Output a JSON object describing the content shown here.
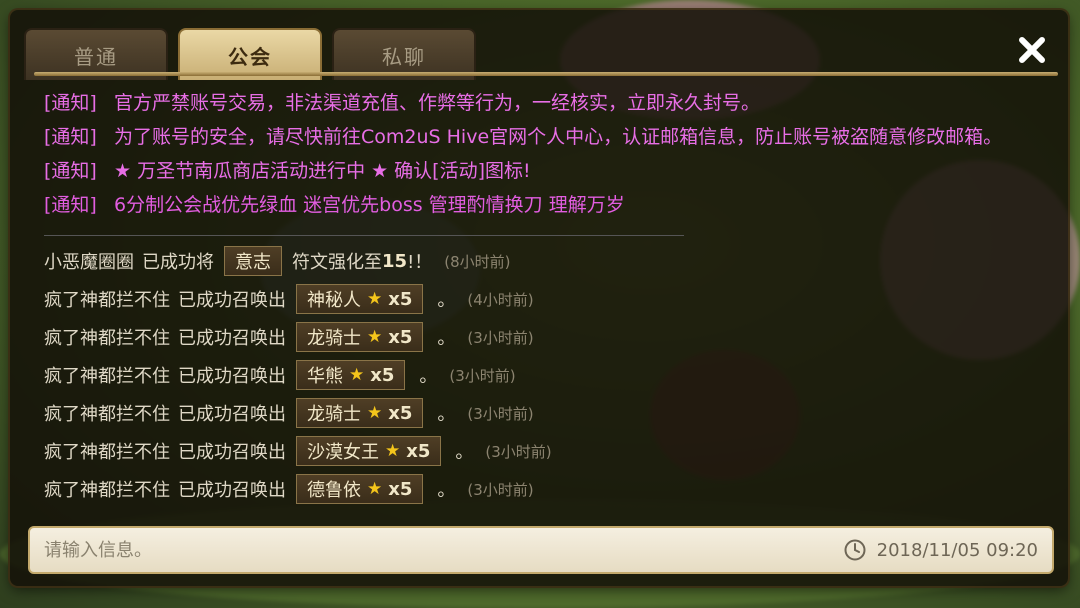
{
  "tabs": [
    {
      "label": "普通",
      "active": false
    },
    {
      "label": "公会",
      "active": true
    },
    {
      "label": "私聊",
      "active": false
    }
  ],
  "close_icon": "close-icon",
  "notices": [
    {
      "tag": "[通知]",
      "text": "官方严禁账号交易，非法渠道充值、作弊等行为，一经核实，立即永久封号。"
    },
    {
      "tag": "[通知]",
      "text": "为了账号的安全，请尽快前往Com2uS Hive官网个人中心，认证邮箱信息，防止账号被盗随意修改邮箱。"
    },
    {
      "tag": "[通知]",
      "text": "★ 万圣节南瓜商店活动进行中 ★ 确认[活动]图标!"
    },
    {
      "tag": "[通知]",
      "text": "6分制公会战优先绿血 迷宫优先boss 管理酌情换刀 理解万岁"
    }
  ],
  "rune_message": {
    "user": "小恶魔圈圈",
    "action": "已成功将",
    "item": "意志",
    "result": "符文强化至",
    "level": "15",
    "suffix": "!！",
    "time": "(8小时前)"
  },
  "summon_messages": [
    {
      "user": "疯了神都拦不住",
      "action": "已成功召唤出",
      "monster": "神秘人",
      "star": "★",
      "count": "x5",
      "punct": "。",
      "time": "(4小时前)"
    },
    {
      "user": "疯了神都拦不住",
      "action": "已成功召唤出",
      "monster": "龙骑士",
      "star": "★",
      "count": "x5",
      "punct": "。",
      "time": "(3小时前)"
    },
    {
      "user": "疯了神都拦不住",
      "action": "已成功召唤出",
      "monster": "华熊",
      "star": "★",
      "count": "x5",
      "punct": "。",
      "time": "(3小时前)"
    },
    {
      "user": "疯了神都拦不住",
      "action": "已成功召唤出",
      "monster": "龙骑士",
      "star": "★",
      "count": "x5",
      "punct": "。",
      "time": "(3小时前)"
    },
    {
      "user": "疯了神都拦不住",
      "action": "已成功召唤出",
      "monster": "沙漠女王",
      "star": "★",
      "count": "x5",
      "punct": "。",
      "time": "(3小时前)"
    },
    {
      "user": "疯了神都拦不住",
      "action": "已成功召唤出",
      "monster": "德鲁依",
      "star": "★",
      "count": "x5",
      "punct": "。",
      "time": "(3小时前)"
    }
  ],
  "input": {
    "placeholder": "请输入信息。",
    "value": ""
  },
  "timestamp": "2018/11/05  09:20",
  "colors": {
    "notice": "#e86ee6",
    "message": "#dfd8c6",
    "star": "#f4c51b",
    "tab_active": "#c8ae74"
  }
}
